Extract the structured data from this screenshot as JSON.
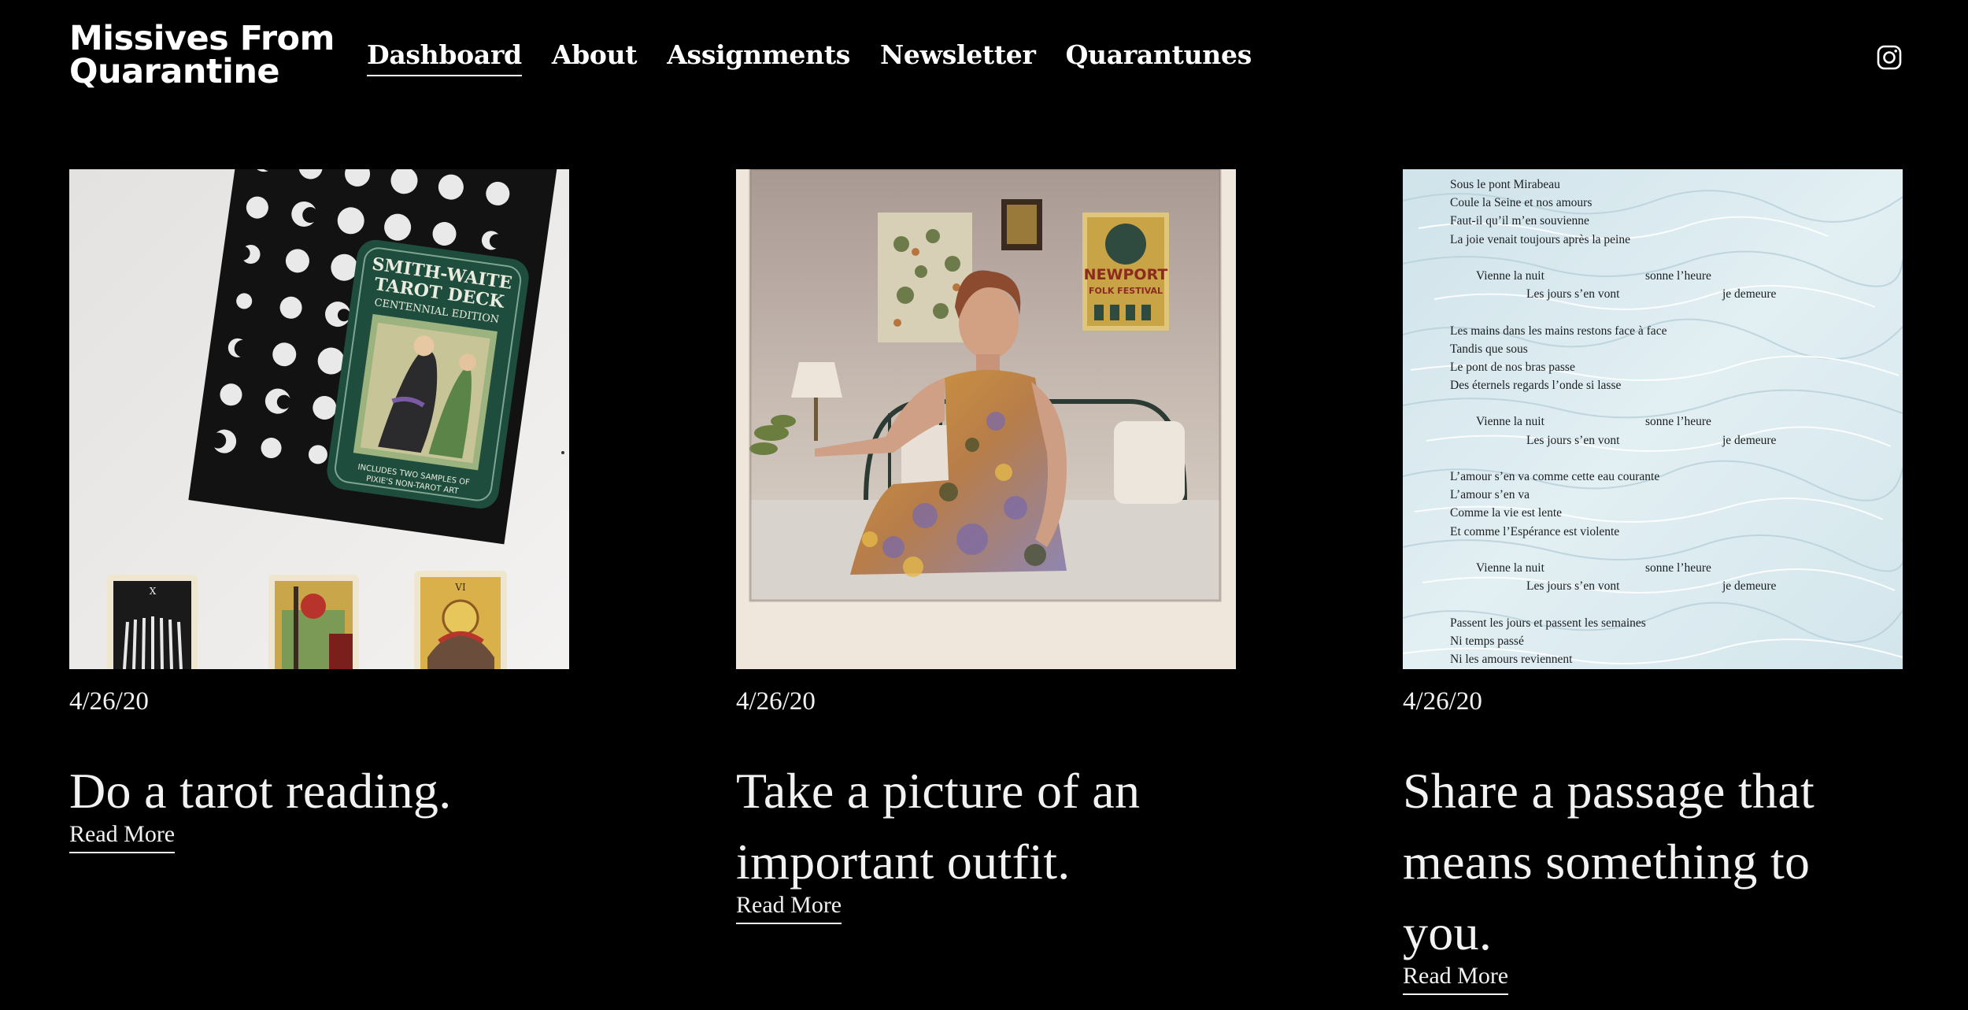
{
  "site": {
    "logo_line1": "Missives From",
    "logo_line2": "Quarantine"
  },
  "nav": {
    "items": [
      {
        "label": "Dashboard",
        "active": true
      },
      {
        "label": "About"
      },
      {
        "label": "Assignments"
      },
      {
        "label": "Newsletter"
      },
      {
        "label": "Quarantunes"
      }
    ]
  },
  "social": {
    "icon": "instagram-icon"
  },
  "cards": [
    {
      "date": "4/26/20",
      "title": "Do a tarot reading.",
      "read_more": "Read More",
      "image": {
        "tin_line1": "SMITH-WAITE",
        "tin_line2": "TAROT DECK",
        "tin_line3": "CENTENNIAL EDITION",
        "tin_footer1": "INCLUDES TWO SAMPLES OF",
        "tin_footer2": "PIXIE'S NON-TAROT ART",
        "card_numeral_1": "X",
        "card_numeral_2": "VI"
      }
    },
    {
      "date": "4/26/20",
      "title": "Take a picture of an important outfit.",
      "read_more": "Read More",
      "image": {
        "poster_line1": "NEWPORT",
        "poster_line2": "FOLK FESTIVAL"
      }
    },
    {
      "date": "4/26/20",
      "title": "Share a passage that means something to you.",
      "read_more": "Read More",
      "image": {
        "poem": {
          "s1": [
            "Sous le pont Mirabeau",
            "Coule la Seine et nos amours",
            "Faut-il qu’il m’en souvienne",
            "La joie venait toujours après la peine"
          ],
          "refrain_a1": "Vienne la nuit",
          "refrain_b1": "sonne l’heure",
          "refrain_a2": "Les jours s’en vont",
          "refrain_b2": "je demeure",
          "s2": [
            "Les mains dans les mains restons face à face",
            "Tandis que sous",
            "Le pont de nos bras passe",
            "Des éternels regards l’onde si lasse"
          ],
          "s3": [
            "L’amour s’en va comme cette eau courante",
            "L’amour s’en va",
            "Comme la vie est lente",
            "Et comme l’Espérance est violente"
          ],
          "s4": [
            "Passent les jours et passent les semaines",
            "Ni temps passé",
            "Ni les amours reviennent"
          ]
        }
      }
    }
  ]
}
